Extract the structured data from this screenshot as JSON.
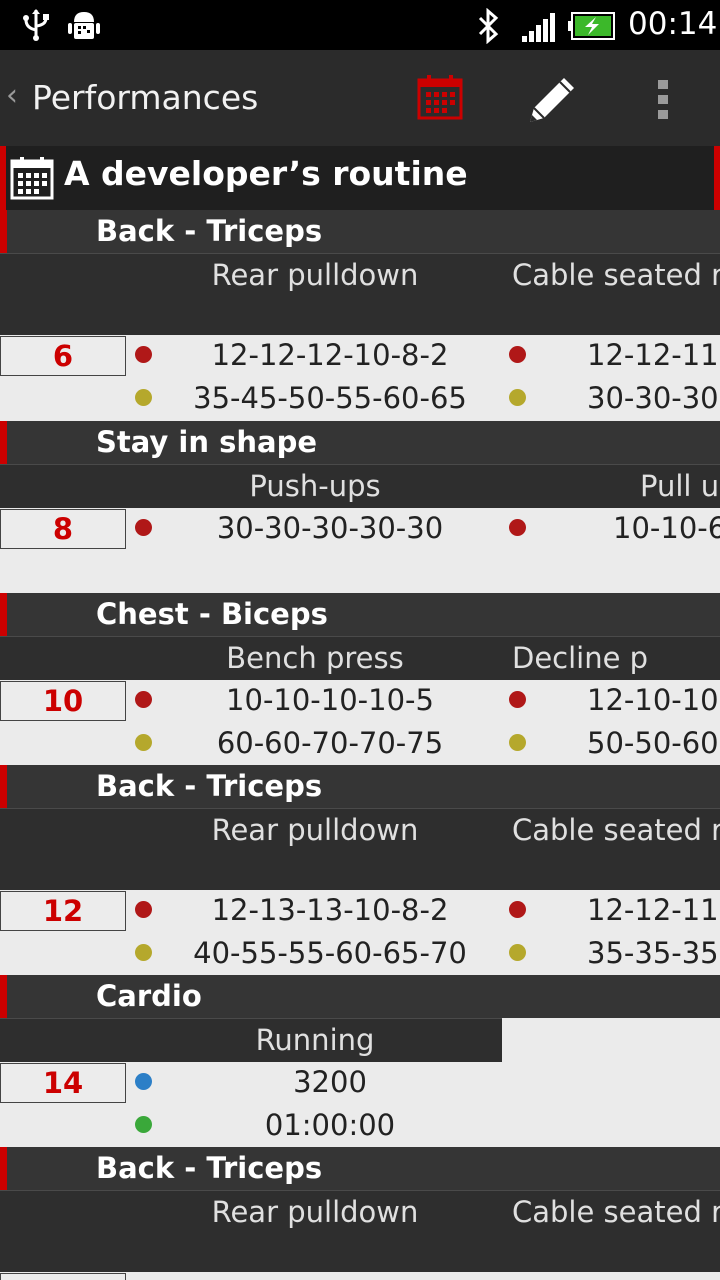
{
  "status_bar": {
    "time": "00:14"
  },
  "action_bar": {
    "back_glyph": "‹",
    "title": "Performances"
  },
  "routine": {
    "title": "A developer’s routine"
  },
  "sections": [
    {
      "group": "Back - Triceps",
      "exercises": [
        "Rear pulldown",
        "Cable seated r"
      ],
      "day": "6",
      "rows": [
        {
          "dot": "red",
          "values": [
            "12-12-12-10-8-2",
            "12-12-11"
          ]
        },
        {
          "dot": "yellow",
          "values": [
            "35-45-50-55-60-65",
            "30-30-30"
          ]
        }
      ]
    },
    {
      "group": "Stay in shape",
      "exercises": [
        "Push-ups",
        "Pull u"
      ],
      "day": "8",
      "rows": [
        {
          "dot": "red",
          "values": [
            "30-30-30-30-30",
            "10-10-6"
          ]
        }
      ]
    },
    {
      "group": "Chest - Biceps",
      "exercises": [
        "Bench press",
        "Decline p"
      ],
      "day": "10",
      "rows": [
        {
          "dot": "red",
          "values": [
            "10-10-10-10-5",
            "12-10-10"
          ]
        },
        {
          "dot": "yellow",
          "values": [
            "60-60-70-70-75",
            "50-50-60"
          ]
        }
      ]
    },
    {
      "group": "Back - Triceps",
      "exercises": [
        "Rear pulldown",
        "Cable seated r"
      ],
      "day": "12",
      "rows": [
        {
          "dot": "red",
          "values": [
            "12-13-13-10-8-2",
            "12-12-11"
          ]
        },
        {
          "dot": "yellow",
          "values": [
            "40-55-55-60-65-70",
            "35-35-35"
          ]
        }
      ]
    },
    {
      "group": "Cardio",
      "exercises": [
        "Running"
      ],
      "day": "14",
      "rows": [
        {
          "dot": "blue",
          "values": [
            "3200"
          ]
        },
        {
          "dot": "green",
          "values": [
            "01:00:00"
          ]
        }
      ]
    },
    {
      "group": "Back - Triceps",
      "exercises": [
        "Rear pulldown",
        "Cable seated r"
      ],
      "day": "",
      "rows": []
    }
  ],
  "colors": {
    "accent_red": "#cc0000",
    "dot_red": "#b01818",
    "dot_yellow": "#b5a82c",
    "dot_blue": "#2c7fc7",
    "dot_green": "#3aa83a"
  },
  "icons": [
    "usb-icon",
    "android-debug-icon",
    "bluetooth-icon",
    "signal-icon",
    "battery-charging-icon",
    "calendar-icon",
    "edit-pencil-icon",
    "overflow-menu-icon"
  ]
}
